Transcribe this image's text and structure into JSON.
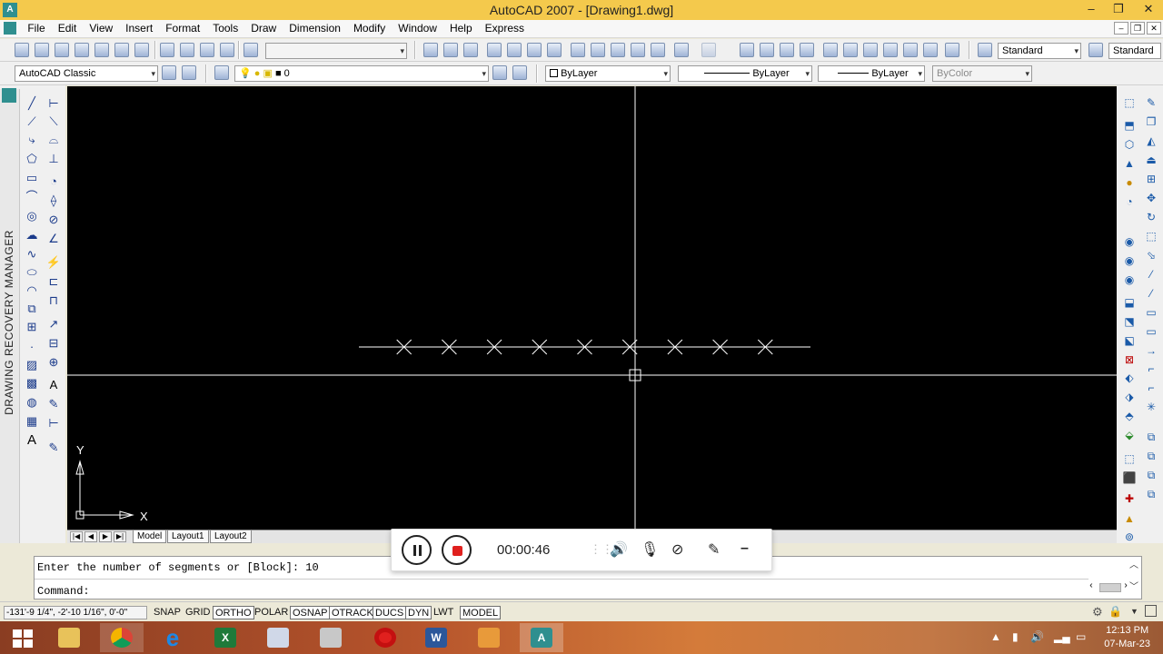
{
  "window": {
    "title": "AutoCAD 2007 - [Drawing1.dwg]",
    "app_icon": "autocad-icon",
    "controls": [
      "–",
      "❐",
      "✕"
    ],
    "mdi_controls": [
      "–",
      "❐",
      "✕"
    ]
  },
  "menu": [
    "File",
    "Edit",
    "View",
    "Insert",
    "Format",
    "Tools",
    "Draw",
    "Dimension",
    "Modify",
    "Window",
    "Help",
    "Express"
  ],
  "toolbar1": {
    "text_style": "Standard",
    "dim_style": "Standard"
  },
  "toolbar2": {
    "workspace": "AutoCAD Classic",
    "layer": "0",
    "color": "ByLayer",
    "linetype": "ByLayer",
    "lineweight": "ByLayer",
    "plotstyle": "ByColor"
  },
  "side_panel": {
    "label": "DRAWING RECOVERY MANAGER"
  },
  "canvas": {
    "background": "#000000",
    "divide_marks": 9,
    "ucs_x": "X",
    "ucs_y": "Y"
  },
  "layout_tabs": {
    "nav": [
      "|◀",
      "◀",
      "▶",
      "▶|"
    ],
    "tabs": [
      "Model",
      "Layout1",
      "Layout2"
    ],
    "active": "Model"
  },
  "command_line": {
    "history": "Enter the number of segments or [Block]: 10",
    "prompt": "Command:"
  },
  "status_bar": {
    "coordinates": "-131'-9 1/4\", -2'-10 1/16\", 0'-0\"",
    "toggles": [
      "SNAP",
      "GRID",
      "ORTHO",
      "POLAR",
      "OSNAP",
      "OTRACK",
      "DUCS",
      "DYN",
      "LWT",
      "MODEL"
    ],
    "on_toggles": [
      "ORTHO",
      "OSNAP",
      "OTRACK",
      "DUCS",
      "DYN",
      "MODEL"
    ]
  },
  "recorder": {
    "time": "00:00:46",
    "icons": [
      "pause-icon",
      "stop-icon",
      "speaker-icon",
      "mic-icon",
      "camera-off-icon",
      "pen-icon",
      "minimize-icon"
    ],
    "stop_color": "#e0201e"
  },
  "taskbar": {
    "apps": [
      "file-explorer",
      "chrome",
      "internet-explorer",
      "excel",
      "paint",
      "calculator",
      "opera",
      "word",
      "media-player",
      "autocad"
    ],
    "clock_time": "12:13 PM",
    "clock_date": "07-Mar-23"
  }
}
